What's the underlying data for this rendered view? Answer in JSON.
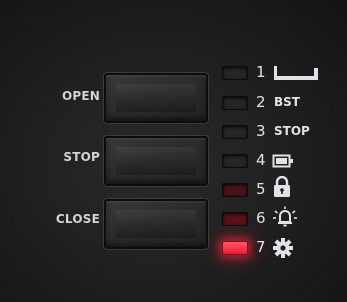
{
  "controls": {
    "open_label": "OPEN",
    "stop_label": "STOP",
    "close_label": "CLOSE"
  },
  "indicators": [
    {
      "number": "1",
      "icon": "door-position-icon",
      "state": "off"
    },
    {
      "number": "2",
      "text": "BST",
      "state": "off"
    },
    {
      "number": "3",
      "text": "STOP",
      "state": "off"
    },
    {
      "number": "4",
      "icon": "battery-icon",
      "state": "off"
    },
    {
      "number": "5",
      "icon": "lock-icon",
      "state": "dim"
    },
    {
      "number": "6",
      "icon": "alarm-bell-icon",
      "state": "dim"
    },
    {
      "number": "7",
      "icon": "gear-icon",
      "state": "on"
    }
  ],
  "colors": {
    "panel": "#1e1e1f",
    "led_on": "#ff2f45",
    "label": "#d3d3d6"
  }
}
